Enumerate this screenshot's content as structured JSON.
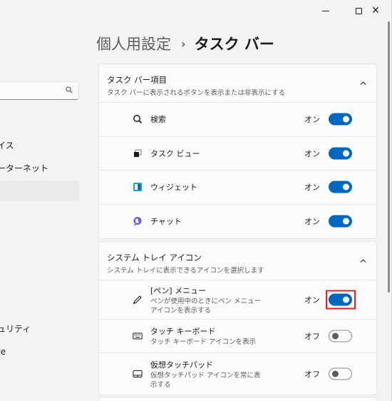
{
  "window": {
    "close_glyph": "✕"
  },
  "sidebar": {
    "items": [
      {
        "label": "イス"
      },
      {
        "label": "ーターネット"
      },
      {
        "label": ""
      },
      {
        "label": "ュリティ"
      },
      {
        "label": "te"
      }
    ]
  },
  "header": {
    "parent": "個人用設定",
    "separator": "›",
    "current": "タスク バー"
  },
  "taskbar_items": {
    "title": "タスク バー項目",
    "subtitle": "タスク バーに表示されるボタンを表示または非表示にする",
    "rows": [
      {
        "icon": "search-icon",
        "label": "検索",
        "state": "オン",
        "on": true
      },
      {
        "icon": "task-view-icon",
        "label": "タスク ビュー",
        "state": "オン",
        "on": true
      },
      {
        "icon": "widgets-icon",
        "label": "ウィジェット",
        "state": "オン",
        "on": true
      },
      {
        "icon": "chat-icon",
        "label": "チャット",
        "state": "オン",
        "on": true
      }
    ]
  },
  "system_tray": {
    "title": "システム トレイ アイコン",
    "subtitle": "システム トレイに表示できるアイコンを選択します",
    "rows": [
      {
        "icon": "pen-icon",
        "label": "[ペン] メニュー",
        "desc": "ペンが使用中のときにペン メニュー アイコンを表示する",
        "state": "オン",
        "on": true,
        "highlighted": true
      },
      {
        "icon": "keyboard-icon",
        "label": "タッチ キーボード",
        "desc": "タッチ キーボード アイコンを表示",
        "state": "オフ",
        "on": false
      },
      {
        "icon": "touchpad-icon",
        "label": "仮想タッチパッド",
        "desc": "仮想タッチパッド アイコンを常に表示する",
        "state": "オフ",
        "on": false
      }
    ]
  },
  "colors": {
    "accent": "#0067c0",
    "highlight": "#e0202a"
  }
}
